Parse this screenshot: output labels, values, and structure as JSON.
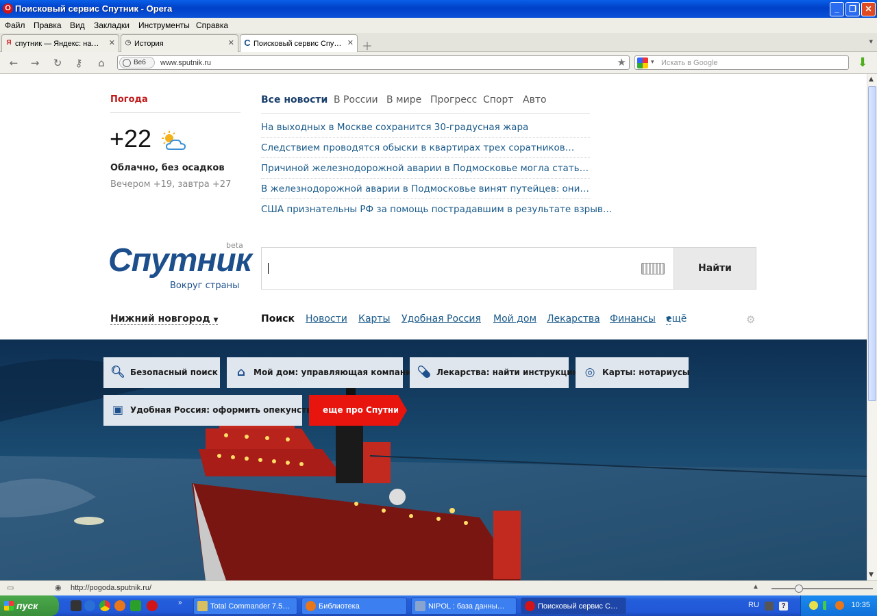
{
  "window": {
    "title": "Поисковый сервис Спутник - Opera"
  },
  "menu": [
    "Файл",
    "Правка",
    "Вид",
    "Закладки",
    "Инструменты",
    "Справка"
  ],
  "tabs": [
    {
      "label": "спутник — Яндекс: на…",
      "icon": "yandex-icon"
    },
    {
      "label": "История",
      "icon": "clock-icon"
    },
    {
      "label": "Поисковый сервис Спу…",
      "icon": "sputnik-icon",
      "active": true
    }
  ],
  "address": {
    "badge": "Веб",
    "url": "www.sputnik.ru"
  },
  "browser_search": {
    "placeholder": "Искать в Google"
  },
  "weather": {
    "heading": "Погода",
    "temp": "+22",
    "condition": "Облачно, без осадков",
    "forecast": "Вечером +19, завтра +27"
  },
  "news": {
    "tabs": [
      "Все новости",
      "В России",
      "В мире",
      "Прогресс",
      "Спорт",
      "Авто"
    ],
    "items": [
      "На выходных в Москве сохранится 30-градусная жара",
      "Следствием проводятся обыски в квартирах трех соратников…",
      "Причиной железнодорожной аварии в Подмосковье могла стать…",
      "В железнодорожной аварии в Подмосковье винят путейцев: они…",
      "США признательны РФ за помощь пострадавшим в результате взрыв…"
    ]
  },
  "logo": {
    "word": "Спутник",
    "beta": "beta",
    "tagline": "Вокруг страны"
  },
  "search": {
    "button": "Найти"
  },
  "region": {
    "city": "Нижний новгород"
  },
  "services": {
    "current": "Поиск",
    "links": [
      "Новости",
      "Карты",
      "Удобная Россия",
      "Мой дом",
      "Лекарства",
      "Финансы"
    ],
    "more": "ещё"
  },
  "promo": [
    {
      "label": "Безопасный поиск",
      "icon": "magnifier-icon"
    },
    {
      "label": "Мой дом: управляющая компания",
      "icon": "house-icon"
    },
    {
      "label": "Лекарства: найти инструкцию",
      "icon": "pill-icon"
    },
    {
      "label": "Карты: нотариусы",
      "icon": "compass-icon"
    },
    {
      "label": "Удобная Россия: оформить опекунство",
      "icon": "sofa-icon"
    },
    {
      "label": "еще про Спутник",
      "icon": ""
    }
  ],
  "status": {
    "url": "http://pogoda.sputnik.ru/"
  },
  "taskbar": {
    "start": "пуск",
    "buttons": [
      {
        "label": "Total Commander 7.5…"
      },
      {
        "label": "Библиотека"
      },
      {
        "label": "NIPOL : база данны…"
      },
      {
        "label": "Поисковый сервис С…",
        "active": true
      }
    ],
    "lang": "RU",
    "clock": "10:35"
  }
}
